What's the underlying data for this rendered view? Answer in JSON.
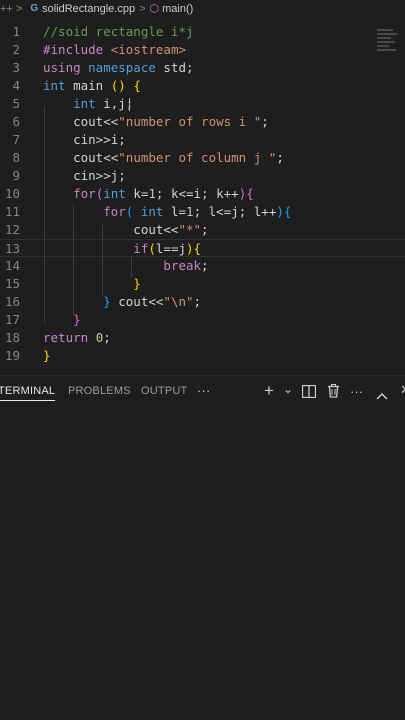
{
  "breadcrumb": {
    "prefix": "++ >",
    "file_badge": "G",
    "file_name": "solidRectangle.cpp",
    "separator": ">",
    "symbol_name": "main()"
  },
  "code_lines": [
    {
      "n": "1",
      "tokens": [
        {
          "t": "//soid rectangle i*j",
          "c": "cm"
        }
      ]
    },
    {
      "n": "2",
      "tokens": [
        {
          "t": "#include ",
          "c": "ctl"
        },
        {
          "t": "<iostream>",
          "c": "str"
        }
      ]
    },
    {
      "n": "3",
      "tokens": [
        {
          "t": "using ",
          "c": "ctl"
        },
        {
          "t": "namespace ",
          "c": "kw"
        },
        {
          "t": "std;",
          "c": "pl"
        }
      ]
    },
    {
      "n": "4",
      "tokens": [
        {
          "t": "int ",
          "c": "kw"
        },
        {
          "t": "main ",
          "c": "pl"
        },
        {
          "t": "() {",
          "c": "br1"
        }
      ]
    },
    {
      "n": "5",
      "tokens": [
        {
          "t": "    int ",
          "c": "kw"
        },
        {
          "t": "i,j;",
          "c": "pl"
        }
      ]
    },
    {
      "n": "6",
      "tokens": [
        {
          "t": "    cout<<",
          "c": "pl"
        },
        {
          "t": "\"number of rows i \"",
          "c": "str"
        },
        {
          "t": ";",
          "c": "pl"
        }
      ]
    },
    {
      "n": "7",
      "tokens": [
        {
          "t": "    cin>>i;",
          "c": "pl"
        }
      ]
    },
    {
      "n": "8",
      "tokens": [
        {
          "t": "    cout<<",
          "c": "pl"
        },
        {
          "t": "\"number of column j \"",
          "c": "str"
        },
        {
          "t": ";",
          "c": "pl"
        }
      ]
    },
    {
      "n": "9",
      "tokens": [
        {
          "t": "    cin>>j;",
          "c": "pl"
        }
      ]
    },
    {
      "n": "10",
      "tokens": [
        {
          "t": "    for",
          "c": "ctl"
        },
        {
          "t": "(",
          "c": "br2"
        },
        {
          "t": "int ",
          "c": "kw"
        },
        {
          "t": "k=",
          "c": "pl"
        },
        {
          "t": "1",
          "c": "num"
        },
        {
          "t": "; k<=i; k++",
          "c": "pl"
        },
        {
          "t": ")",
          "c": "br2"
        },
        {
          "t": "{",
          "c": "br2"
        }
      ]
    },
    {
      "n": "11",
      "tokens": [
        {
          "t": "        for",
          "c": "ctl"
        },
        {
          "t": "( ",
          "c": "br3"
        },
        {
          "t": "int ",
          "c": "kw"
        },
        {
          "t": "l=",
          "c": "pl"
        },
        {
          "t": "1",
          "c": "num"
        },
        {
          "t": "; l<=j; l++",
          "c": "pl"
        },
        {
          "t": ")",
          "c": "br3"
        },
        {
          "t": "{",
          "c": "br3"
        }
      ]
    },
    {
      "n": "12",
      "tokens": [
        {
          "t": "            cout<<",
          "c": "pl"
        },
        {
          "t": "\"*\"",
          "c": "str"
        },
        {
          "t": ";",
          "c": "pl"
        }
      ]
    },
    {
      "n": "13",
      "tokens": [
        {
          "t": "            if",
          "c": "ctl"
        },
        {
          "t": "(",
          "c": "br1"
        },
        {
          "t": "l==j",
          "c": "pl"
        },
        {
          "t": ")",
          "c": "br1"
        },
        {
          "t": "{",
          "c": "br1"
        }
      ]
    },
    {
      "n": "14",
      "tokens": [
        {
          "t": "                break",
          "c": "ctl"
        },
        {
          "t": ";",
          "c": "pl"
        }
      ]
    },
    {
      "n": "15",
      "tokens": [
        {
          "t": "            }",
          "c": "br1"
        }
      ]
    },
    {
      "n": "16",
      "tokens": [
        {
          "t": "        }",
          "c": "br3"
        },
        {
          "t": " cout<<",
          "c": "pl"
        },
        {
          "t": "\"\\n\"",
          "c": "str"
        },
        {
          "t": ";",
          "c": "pl"
        }
      ]
    },
    {
      "n": "17",
      "tokens": [
        {
          "t": "    }",
          "c": "br2"
        }
      ]
    },
    {
      "n": "18",
      "tokens": [
        {
          "t": "return ",
          "c": "ctl"
        },
        {
          "t": "0",
          "c": "num"
        },
        {
          "t": ";",
          "c": "pl"
        }
      ]
    },
    {
      "n": "19",
      "tokens": [
        {
          "t": "}",
          "c": "br1"
        }
      ]
    }
  ],
  "panel": {
    "tabs": [
      {
        "label": "TERMINAL",
        "active": true
      },
      {
        "label": "PROBLEMS",
        "active": false
      },
      {
        "label": "OUTPUT",
        "active": false
      }
    ],
    "more_label": "···",
    "actions": {
      "add": "+",
      "add_dropdown": "⌄",
      "split": "◫",
      "trash": "🗑",
      "more": "···",
      "maximize": "⌃",
      "close": "✕"
    }
  }
}
